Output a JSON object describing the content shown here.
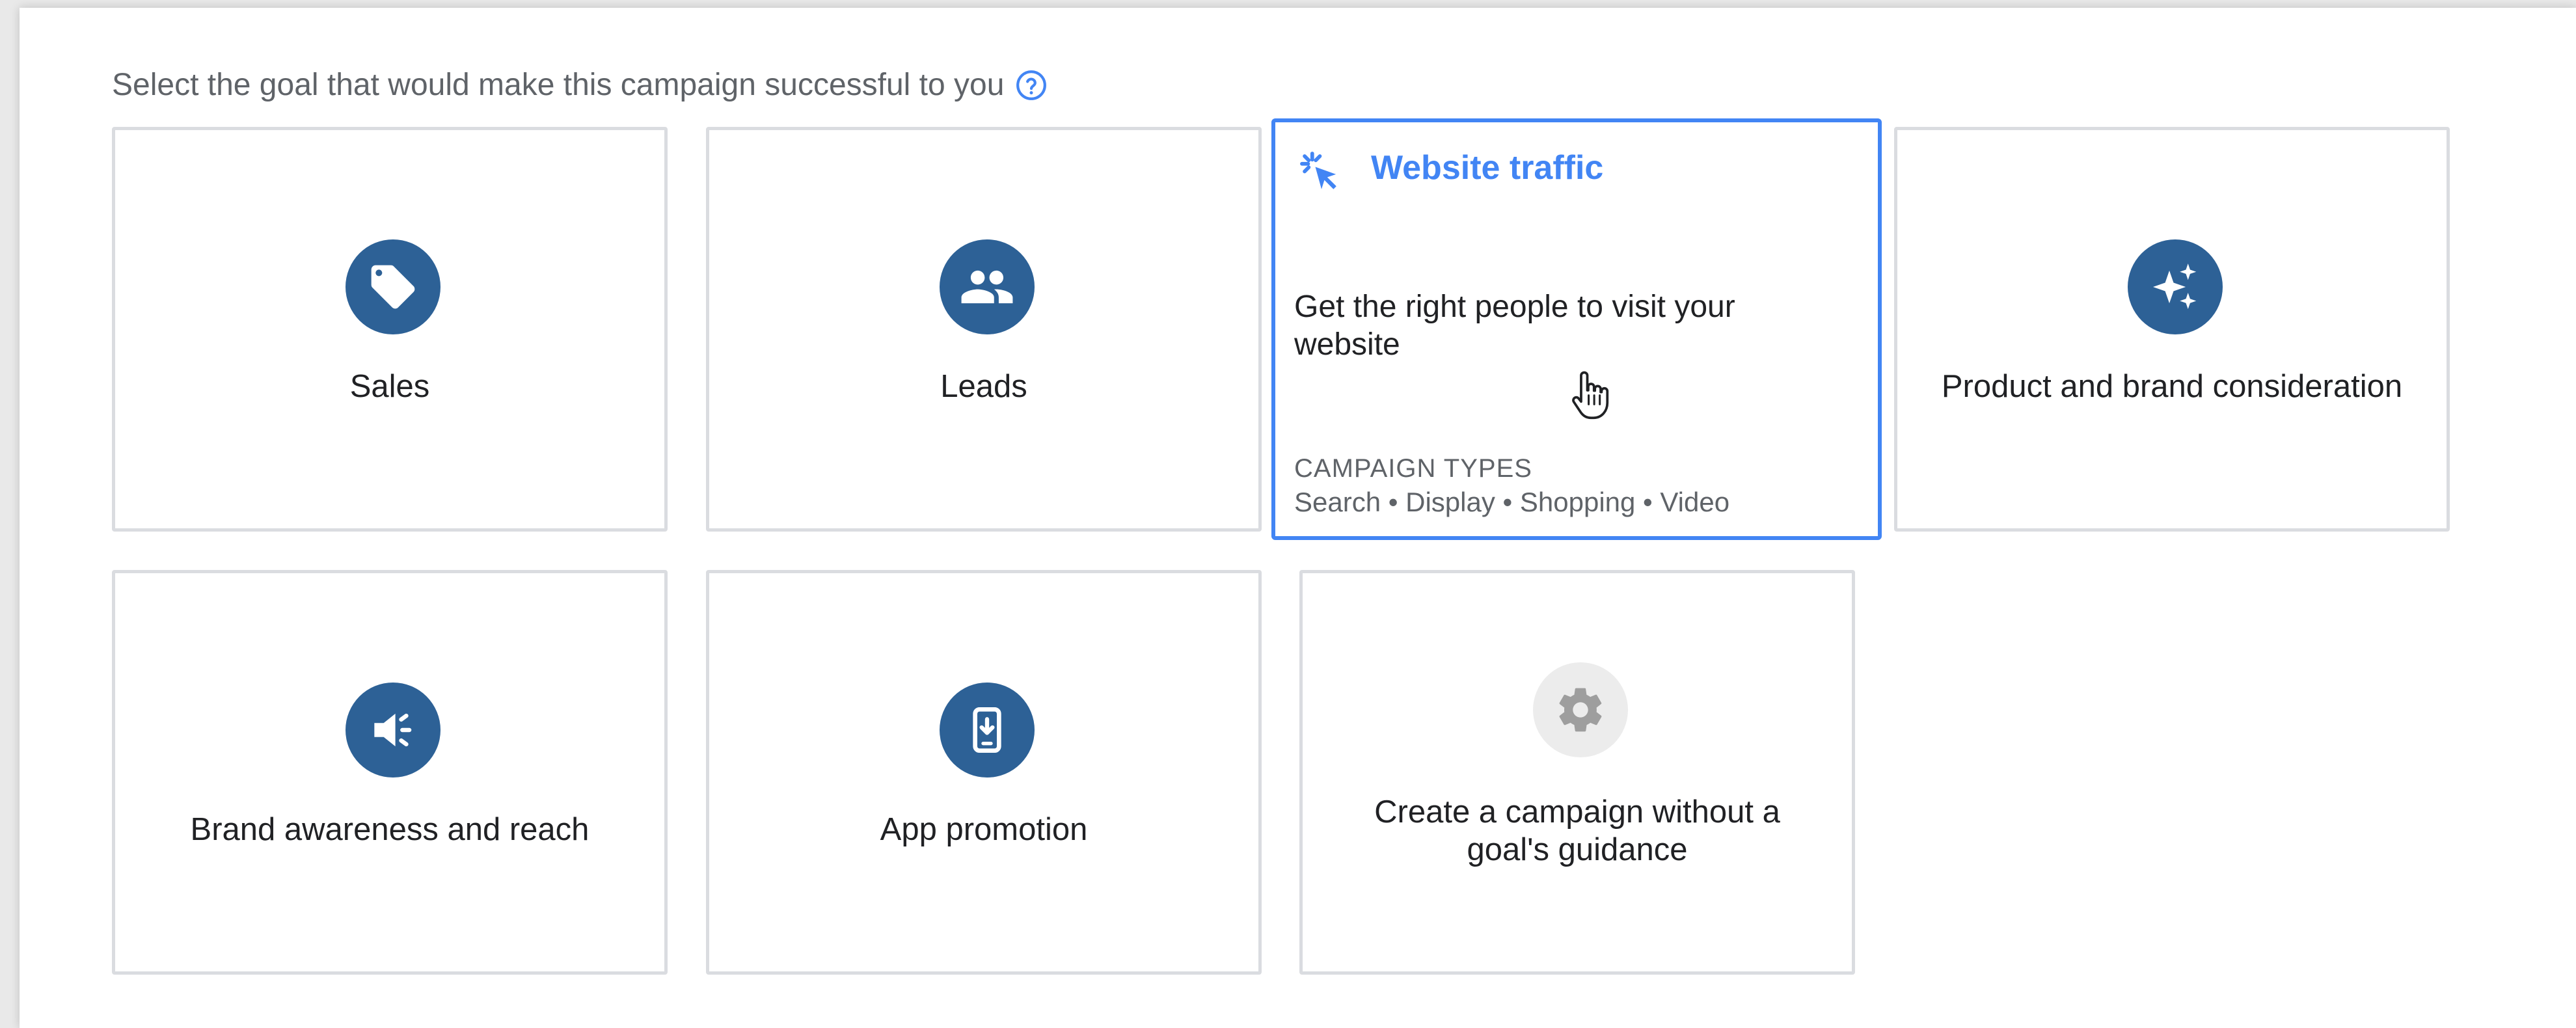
{
  "prompt": {
    "text": "Select the goal that would make this campaign successful to you",
    "help_icon": "help-circle-icon"
  },
  "colors": {
    "accent": "#4285f4",
    "icon_circle": "#2d6196",
    "card_border": "#dadce0",
    "muted_circle": "#ececec"
  },
  "goals": [
    {
      "label": "Sales",
      "icon": "tag-icon"
    },
    {
      "label": "Leads",
      "icon": "people-icon"
    },
    {
      "label": "Website traffic",
      "icon": "cursor-click-icon",
      "selected": true,
      "description": "Get the right people to visit your website",
      "campaign_types_label": "CAMPAIGN TYPES",
      "campaign_types": "Search • Display • Shopping • Video"
    },
    {
      "label": "Product and brand consideration",
      "icon": "sparkle-icon"
    },
    {
      "label": "Brand awareness and reach",
      "icon": "megaphone-icon"
    },
    {
      "label": "App promotion",
      "icon": "phone-download-icon"
    },
    {
      "label": "Create a campaign without a goal's guidance",
      "icon": "gear-icon"
    }
  ]
}
